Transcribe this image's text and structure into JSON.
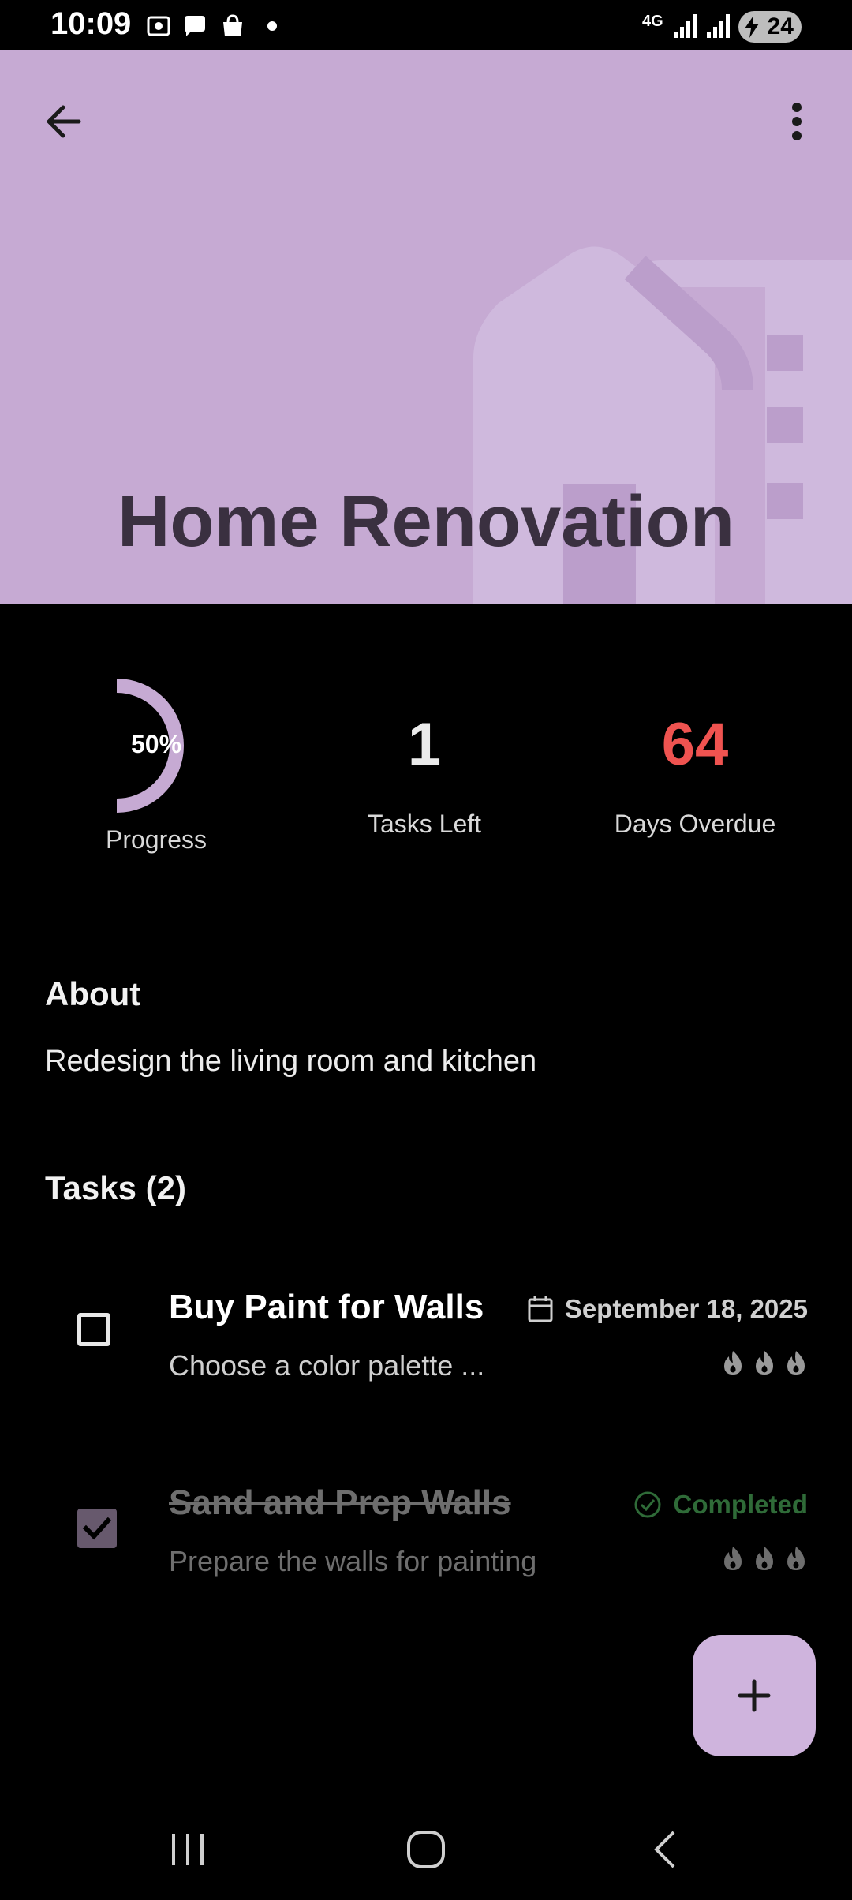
{
  "status_bar": {
    "time": "10:09",
    "network": "4G",
    "battery": "24",
    "icons": [
      "screenshot-icon",
      "chat-icon",
      "shopping-bag-icon",
      "dot-icon",
      "signal-icon",
      "signal-icon",
      "battery-charging-icon"
    ]
  },
  "header": {
    "title": "Home Renovation",
    "background_color": "#c6aad3",
    "back_icon": "arrow-left-icon",
    "menu_icon": "more-vert-icon",
    "art_icon": "house-icon"
  },
  "stats": {
    "progress": {
      "value": 0.5,
      "display": "50%",
      "label": "Progress"
    },
    "tasks_left": {
      "value": "1",
      "label": "Tasks Left"
    },
    "days_overdue": {
      "value": "64",
      "label": "Days Overdue",
      "color": "#ef5350"
    }
  },
  "about": {
    "heading": "About",
    "text": "Redesign the living room and kitchen"
  },
  "tasks": {
    "heading": "Tasks (2)",
    "items": [
      {
        "title": "Buy Paint for Walls",
        "description": "Choose a color palette ...",
        "due": "September 18, 2025",
        "checked": false,
        "priority_icons": [
          "flame-icon",
          "flame-icon",
          "flame-icon"
        ]
      },
      {
        "title": "Sand and Prep Walls",
        "description": "Prepare the walls for painting",
        "status": "Completed",
        "checked": true,
        "priority_icons": [
          "flame-icon",
          "flame-icon",
          "flame-icon"
        ]
      }
    ]
  },
  "fab": {
    "icon": "plus-icon"
  },
  "nav_bar": {
    "icons": [
      "recents-icon",
      "home-icon",
      "back-icon"
    ]
  }
}
